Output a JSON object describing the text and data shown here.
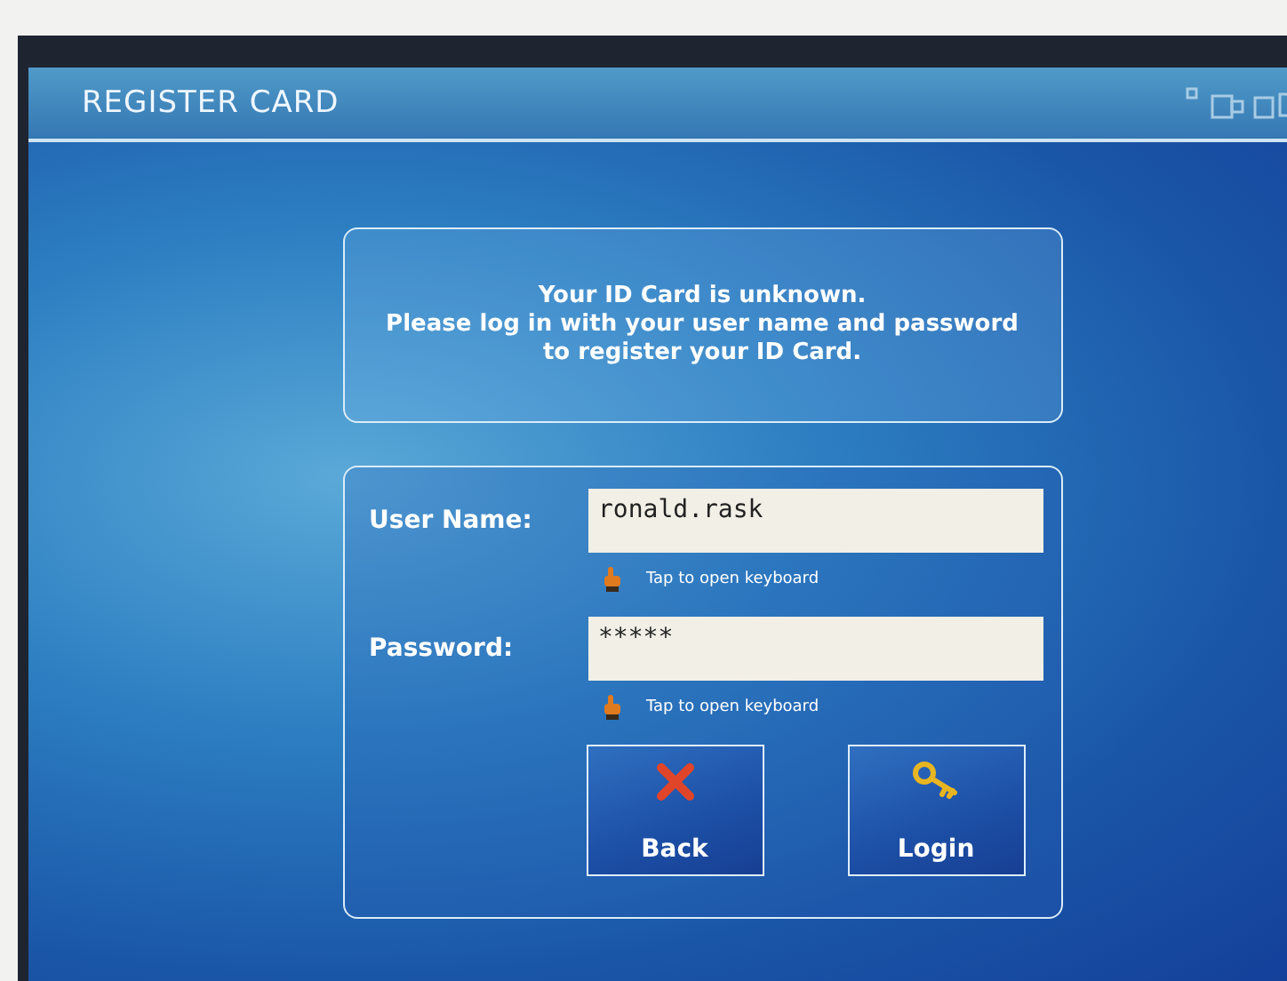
{
  "header": {
    "title": "REGISTER CARD"
  },
  "message": {
    "lines": [
      "Your ID Card is unknown.",
      "Please log in with your user name and password",
      "to register your ID Card."
    ]
  },
  "fields": [
    {
      "label": "User Name:",
      "value": "ronald.rask",
      "hint": "Tap to open keyboard"
    },
    {
      "label": "Password:",
      "value": "*****",
      "hint": "Tap to open keyboard"
    }
  ],
  "buttons": [
    {
      "kind": "back",
      "label": "Back"
    },
    {
      "kind": "login",
      "label": "Login"
    }
  ]
}
